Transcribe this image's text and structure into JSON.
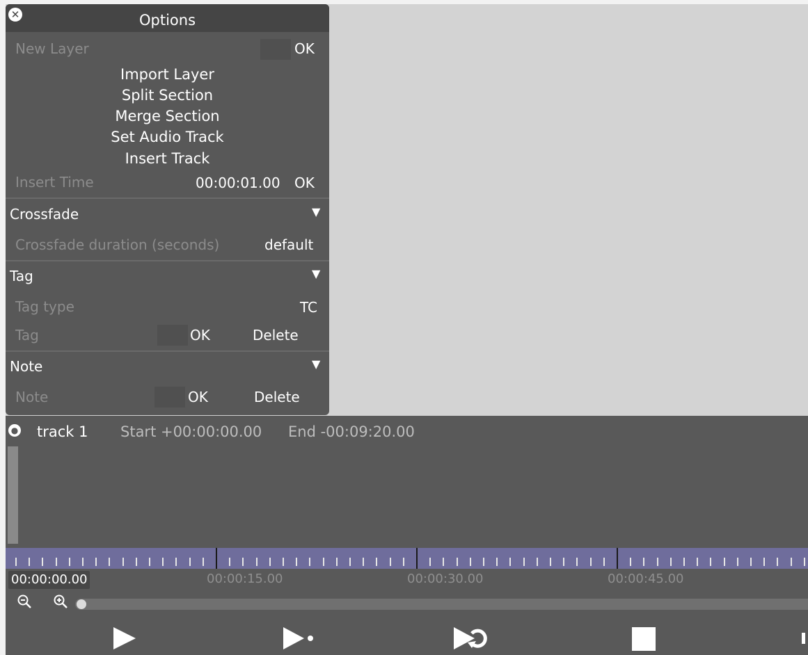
{
  "options": {
    "title": "Options",
    "new_layer": {
      "label": "New Layer",
      "ok": "OK"
    },
    "menu_items": [
      "Import Layer",
      "Split Section",
      "Merge Section",
      "Set Audio Track",
      "Insert Track"
    ],
    "insert_time": {
      "label": "Insert Time",
      "value": "00:00:01.00",
      "ok": "OK"
    }
  },
  "crossfade": {
    "header": "Crossfade",
    "duration_label": "Crossfade duration (seconds)",
    "duration_value": "default"
  },
  "tag": {
    "header": "Tag",
    "type_label": "Tag type",
    "type_value": "TC",
    "tag_label": "Tag",
    "ok": "OK",
    "delete": "Delete"
  },
  "note": {
    "header": "Note",
    "note_label": "Note",
    "ok": "OK",
    "delete": "Delete"
  },
  "track": {
    "name": "track 1",
    "start": "Start +00:00:00.00",
    "end": "End -00:09:20.00"
  },
  "timeline": {
    "current_time": "00:00:00.00",
    "labels": [
      "00:00:15.00",
      "00:00:30.00",
      "00:00:45.00"
    ]
  },
  "icons": {
    "close": "close-circle-icon",
    "track": "track-pin-icon",
    "zoom_out": "zoom-out-icon",
    "zoom_in": "zoom-in-icon",
    "play": "play-icon",
    "play_from": "play-from-icon",
    "loop": "loop-play-icon",
    "stop": "stop-icon"
  },
  "colors": {
    "panel": "#585858",
    "panel_header": "#454545",
    "timeline": "#6f6d9c",
    "track_background": "#595959",
    "canvas": "#d3d3d3"
  }
}
